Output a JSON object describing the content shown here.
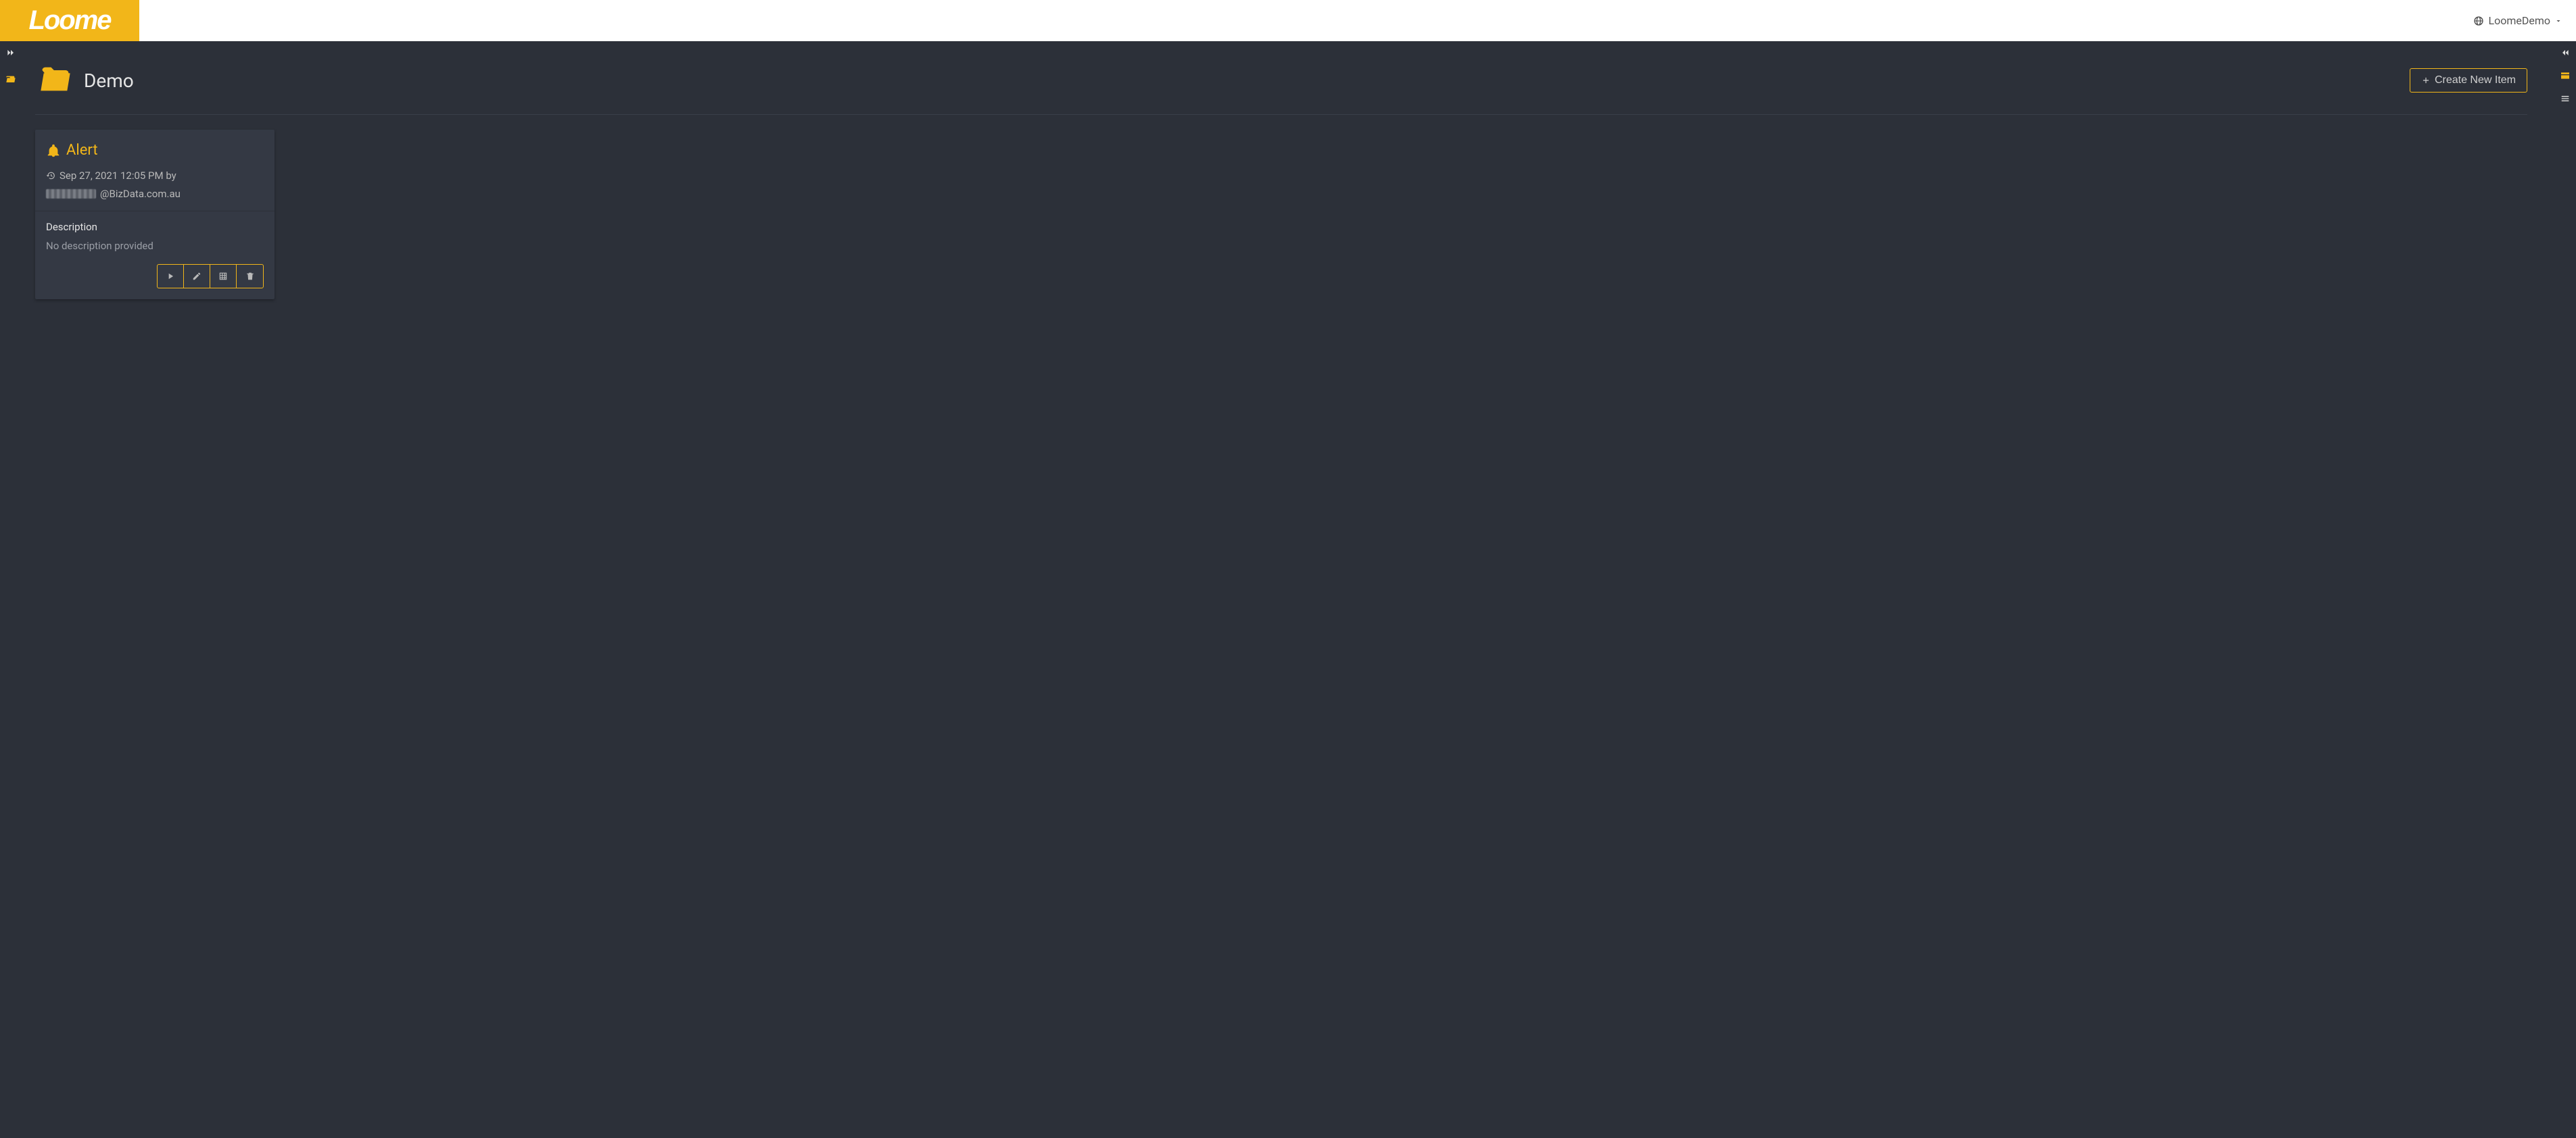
{
  "header": {
    "logo_text": "Loome",
    "tenant_label": "LoomeDemo"
  },
  "page": {
    "title": "Demo",
    "create_button_label": "Create New Item"
  },
  "card": {
    "title": "Alert",
    "timestamp": "Sep 27, 2021 12:05 PM by",
    "author_suffix": "@BizData.com.au",
    "description_label": "Description",
    "description_text": "No description provided"
  }
}
